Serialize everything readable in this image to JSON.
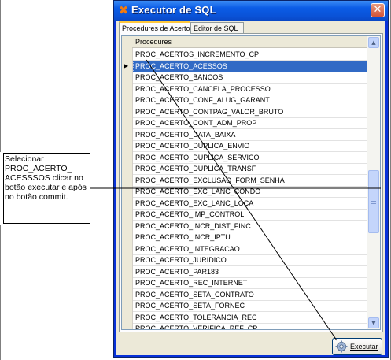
{
  "window": {
    "title": "Executor de SQL",
    "close_glyph": "✕"
  },
  "tabs": [
    {
      "label": "Procedures de Acerto",
      "active": true
    },
    {
      "label": "Editor de SQL",
      "active": false
    }
  ],
  "grid": {
    "column_header": "Procedures",
    "selected_indicator": "▶",
    "rows": [
      "PROC_ACERTOS_INCREMENTO_CP",
      "PROC_ACERTO_ACESSOS",
      "PROC_ACERTO_BANCOS",
      "PROC_ACERTO_CANCELA_PROCESSO",
      "PROC_ACERTO_CONF_ALUG_GARANT",
      "PROC_ACERTO_CONTPAG_VALOR_BRUTO",
      "PROC_ACERTO_CONT_ADM_PROP",
      "PROC_ACERTO_DATA_BAIXA",
      "PROC_ACERTO_DUPLICA_ENVIO",
      "PROC_ACERTO_DUPLICA_SERVICO",
      "PROC_ACERTO_DUPLICA_TRANSF",
      "PROC_ACERTO_EXCLUSAO_FORM_SENHA",
      "PROC_ACERTO_EXC_LANC_CONDO",
      "PROC_ACERTO_EXC_LANC_LOCA",
      "PROC_ACERTO_IMP_CONTROL",
      "PROC_ACERTO_INCR_DIST_FINC",
      "PROC_ACERTO_INCR_IPTU",
      "PROC_ACERTO_INTEGRACAO",
      "PROC_ACERTO_JURIDICO",
      "PROC_ACERTO_PAR183",
      "PROC_ACERTO_REC_INTERNET",
      "PROC_ACERTO_SETA_CONTRATO",
      "PROC_ACERTO_SETA_FORNEC",
      "PROC_ACERTO_TOLERANCIA_REC",
      "PROC_ACERTO_VERIFICA_REF_CP"
    ],
    "selected_row": "PROC_ACERTO_ACESSOS"
  },
  "execute_button": {
    "label": "Executar",
    "icon": "gears-icon"
  },
  "annotation": {
    "text": "Selecionar PROC_ACERTO_ ACESSSOS clicar no botão executar e após no botão commit."
  },
  "colors": {
    "selection": "#316ac5",
    "titlebar": "#0b5ce6"
  },
  "icons": {
    "title": "tools-icon",
    "close": "close-icon"
  }
}
